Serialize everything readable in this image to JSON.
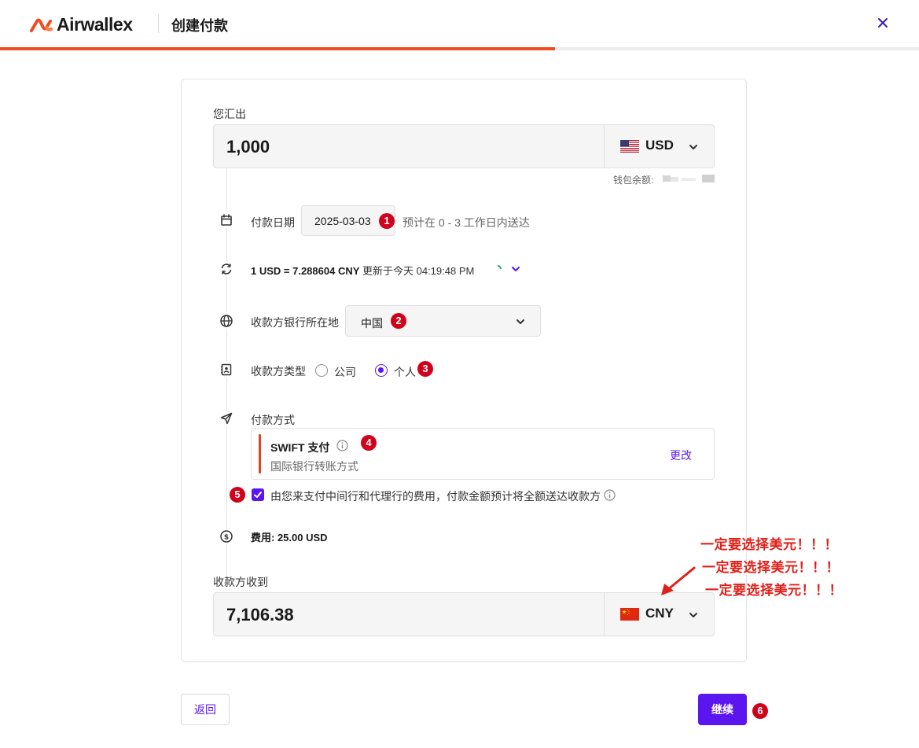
{
  "header": {
    "logo_text": "Airwallex",
    "title": "创建付款",
    "progress_fraction": 0.604
  },
  "send": {
    "label": "您汇出",
    "amount": "1,000",
    "currency": "USD",
    "flag_icon": "us-flag-icon",
    "balance_label": "钱包余额:"
  },
  "payment_date": {
    "label": "付款日期",
    "value": "2025-03-03",
    "hint": "预计在 0 - 3 工作日内送达"
  },
  "rate": {
    "rate_bold": "1 USD = 7.288604 CNY",
    "updated_text": " 更新于今天 04:19:48 PM"
  },
  "bank_location": {
    "label": "收款方银行所在地",
    "value": "中国"
  },
  "recipient_type": {
    "label": "收款方类型",
    "options": [
      "公司",
      "个人"
    ],
    "selected": "个人"
  },
  "payment_method": {
    "label": "付款方式",
    "title": "SWIFT 支付",
    "subtitle": "国际银行转账方式",
    "change_label": "更改"
  },
  "fee_option": {
    "checked": true,
    "label": "由您来支付中间行和代理行的费用，付款金额预计将全额送达收款方"
  },
  "fee": {
    "text": "费用: 25.00 USD"
  },
  "receive": {
    "label": "收款方收到",
    "amount": "7,106.38",
    "currency": "CNY",
    "flag_icon": "cn-flag-icon"
  },
  "footer": {
    "back_label": "返回",
    "next_label": "继续"
  },
  "annotations": {
    "badges": [
      "1",
      "2",
      "3",
      "4",
      "5",
      "6"
    ],
    "notes": [
      "一定要选择美元！！！",
      "一定要选择美元！！！",
      "一定要选择美元！！！"
    ],
    "color": "#e0201a"
  },
  "colors": {
    "brand_orange": "#f04a23",
    "accent_purple": "#5b16f0",
    "badge_red": "#d0021b"
  }
}
